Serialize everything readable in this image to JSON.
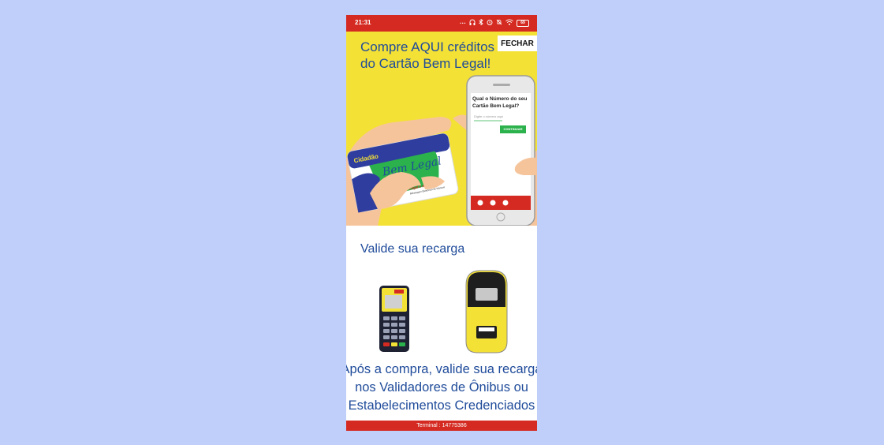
{
  "status_bar": {
    "time": "21:31",
    "battery": "69",
    "icons": [
      "more-icon",
      "headphones-icon",
      "bluetooth-icon",
      "alarm-icon",
      "mute-icon",
      "wifi-icon",
      "battery-icon"
    ]
  },
  "banner": {
    "headline_line1": "Compre AQUI créditos",
    "headline_line2": "do Cartão Bem Legal!",
    "close_label": "FECHAR",
    "card": {
      "brand_top": "Cidadão",
      "brand_script": "Bem Legal",
      "tagline": "Legal é mobilidade!",
      "subtagline": "Bilhetagem Eletrônica de Manaus"
    },
    "phone_screen": {
      "question": "Qual o Número do seu Cartão Bem Legal?",
      "input_placeholder": "Digite o número aqui",
      "button_label": "CONTINUAR"
    }
  },
  "validate": {
    "title": "Valide sua recarga",
    "text_line1": "Após a compra, valide sua recarga",
    "text_line2": "nos Validadores de Ônibus ou",
    "text_line3": "Estabelecimentos Credenciados"
  },
  "footer": {
    "terminal": "Terminal : 14775386"
  },
  "colors": {
    "statusbar": "#d42a21",
    "banner_bg": "#f4e136",
    "primary_text": "#1f4b9a",
    "page_bg": "#c0cff9"
  }
}
